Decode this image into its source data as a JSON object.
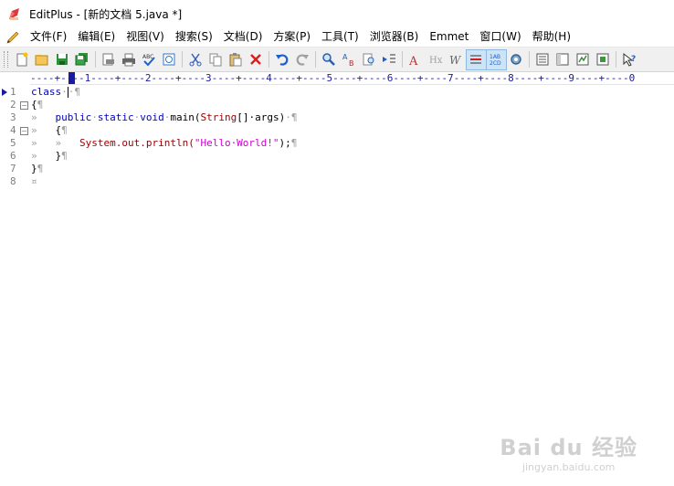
{
  "window": {
    "title": "EditPlus - [新的文档 5.java *]"
  },
  "menu": {
    "items": [
      "文件(F)",
      "编辑(E)",
      "视图(V)",
      "搜索(S)",
      "文档(D)",
      "方案(P)",
      "工具(T)",
      "浏览器(B)",
      "Emmet",
      "窗口(W)",
      "帮助(H)"
    ]
  },
  "toolbar": {
    "buttons": [
      "new-file",
      "open-folder",
      "save",
      "save-all",
      "print-preview",
      "print",
      "spell-check",
      "browser-view",
      "cut",
      "copy",
      "paste",
      "delete",
      "undo",
      "redo",
      "find",
      "replace",
      "find-in-files",
      "goto",
      "font",
      "hex",
      "word-wrap",
      "ruler",
      "line-numbers",
      "preferences",
      "clip-text",
      "cliptext-window",
      "html-toolbar",
      "user-tools",
      "help-context"
    ]
  },
  "ruler": {
    "text": "----+----1----+----2----+----3----+----4----+----5----+----6----+----7----+----8----+----9----+----0"
  },
  "editor": {
    "line_numbers": [
      "1",
      "2",
      "3",
      "4",
      "5",
      "6",
      "7",
      "8"
    ],
    "lines": [
      {
        "text": "class"
      },
      {
        "text": "{"
      },
      {
        "indent": "»   ",
        "k1": "public",
        "k2": "static",
        "k3": "void",
        "name": "main(",
        "type": "String",
        "rest": "[]·args)"
      },
      {
        "indent": "»   ",
        "text": "{"
      },
      {
        "indent": "»   »   ",
        "obj": "System.out.println(",
        "str": "\"Hello·World!\"",
        "tail": ");"
      },
      {
        "indent": "»   ",
        "text": "}"
      },
      {
        "text": "}"
      },
      {
        "text": ""
      }
    ],
    "pilcrow": "¶",
    "eof_mark": "¤"
  },
  "watermark": {
    "main": "Bai du 经验",
    "sub": "jingyan.baidu.com"
  }
}
